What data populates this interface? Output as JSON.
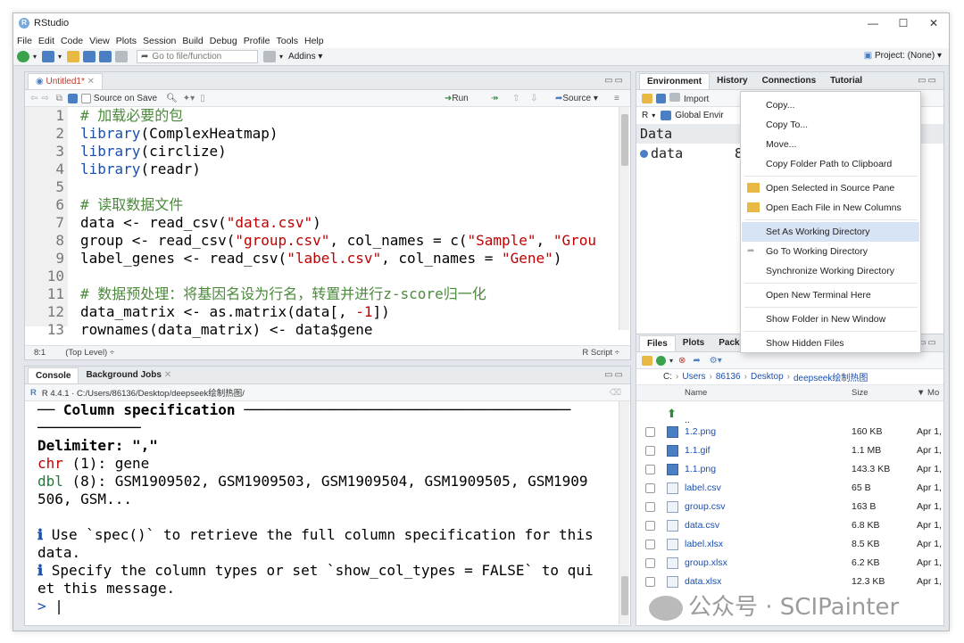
{
  "window": {
    "title": "RStudio"
  },
  "menu": [
    "File",
    "Edit",
    "Code",
    "View",
    "Plots",
    "Session",
    "Build",
    "Debug",
    "Profile",
    "Tools",
    "Help"
  ],
  "toolbar": {
    "goto_placeholder": "Go to file/function",
    "addins": "Addins",
    "project": "Project: (None)"
  },
  "source": {
    "tab": "Untitled1*",
    "source_on_save": "Source on Save",
    "run": "Run",
    "source_btn": "Source",
    "lines": [
      {
        "n": "1",
        "text": "# 加载必要的包"
      },
      {
        "n": "2",
        "text": "library(ComplexHeatmap)"
      },
      {
        "n": "3",
        "text": "library(circlize)"
      },
      {
        "n": "4",
        "text": "library(readr)"
      },
      {
        "n": "5",
        "text": ""
      },
      {
        "n": "6",
        "text": "# 读取数据文件"
      },
      {
        "n": "7",
        "text": "data <- read_csv(\"data.csv\")"
      },
      {
        "n": "8",
        "text": "group <- read_csv(\"group.csv\", col_names = c(\"Sample\", \"Grou"
      },
      {
        "n": "9",
        "text": "label_genes <- read_csv(\"label.csv\", col_names = \"Gene\")"
      },
      {
        "n": "10",
        "text": ""
      },
      {
        "n": "11",
        "text": "# 数据预处理：将基因名设为行名，转置并进行z-score归一化"
      },
      {
        "n": "12",
        "text": "data_matrix <- as.matrix(data[, -1])"
      },
      {
        "n": "13",
        "text": "rownames(data_matrix) <- data$gene"
      }
    ],
    "status_pos": "8:1",
    "status_scope": "(Top Level) ÷",
    "status_type": "R Script ÷"
  },
  "console": {
    "tabs": [
      "Console",
      "Background Jobs"
    ],
    "path": "R 4.4.1 · C:/Users/86136/Desktop/deepseek绘制热图/",
    "lines": [
      "── Column specification ──────────────────────────────────────",
      "────────────",
      "Delimiter: \",\"",
      "chr (1): gene",
      "dbl (8): GSM1909502, GSM1909503, GSM1909504, GSM1909505, GSM1909",
      "506, GSM...",
      "",
      "ℹ Use `spec()` to retrieve the full column specification for this",
      "data.",
      "ℹ Specify the column types or set `show_col_types = FALSE` to qui",
      "et this message.",
      "> "
    ]
  },
  "env": {
    "tabs": [
      "Environment",
      "History",
      "Connections",
      "Tutorial"
    ],
    "import": "Import",
    "r_label": "R",
    "global": "Global Envir",
    "section": "Data",
    "rows": [
      {
        "name": "data",
        "value": "8"
      }
    ]
  },
  "files": {
    "tabs": [
      "Files",
      "Plots",
      "Packag"
    ],
    "path": [
      "C:",
      "Users",
      "86136",
      "Desktop",
      "deepseek绘制热图"
    ],
    "col_name": "Name",
    "col_size": "Size",
    "col_mod": "▼ Mo",
    "items": [
      {
        "name": "..",
        "size": "",
        "mod": "",
        "kind": "up"
      },
      {
        "name": "1.2.png",
        "size": "160 KB",
        "mod": "Apr 1,",
        "kind": "img"
      },
      {
        "name": "1.1.gif",
        "size": "1.1 MB",
        "mod": "Apr 1,",
        "kind": "img"
      },
      {
        "name": "1.1.png",
        "size": "143.3 KB",
        "mod": "Apr 1,",
        "kind": "img"
      },
      {
        "name": "label.csv",
        "size": "65 B",
        "mod": "Apr 1,",
        "kind": "doc"
      },
      {
        "name": "group.csv",
        "size": "163 B",
        "mod": "Apr 1,",
        "kind": "doc"
      },
      {
        "name": "data.csv",
        "size": "6.8 KB",
        "mod": "Apr 1,",
        "kind": "doc"
      },
      {
        "name": "label.xlsx",
        "size": "8.5 KB",
        "mod": "Apr 1,",
        "kind": "doc"
      },
      {
        "name": "group.xlsx",
        "size": "6.2 KB",
        "mod": "Apr 1,",
        "kind": "doc"
      },
      {
        "name": "data.xlsx",
        "size": "12.3 KB",
        "mod": "Apr 1,",
        "kind": "doc"
      }
    ]
  },
  "context_menu": {
    "items": [
      "Copy...",
      "Copy To...",
      "Move...",
      "Copy Folder Path to Clipboard",
      "Open Selected in Source Pane",
      "Open Each File in New Columns",
      "Set As Working Directory",
      "Go To Working Directory",
      "Synchronize Working Directory",
      "Open New Terminal Here",
      "Show Folder in New Window",
      "Show Hidden Files"
    ],
    "highlighted": "Set As Working Directory"
  },
  "watermark": "公众号 · SCIPainter",
  "colors": {
    "accent": "#75aadb",
    "highlight": "#d7e4f5",
    "string": "#c00000",
    "keyword": "#1a4fb0",
    "comment": "#4a8a3a"
  }
}
